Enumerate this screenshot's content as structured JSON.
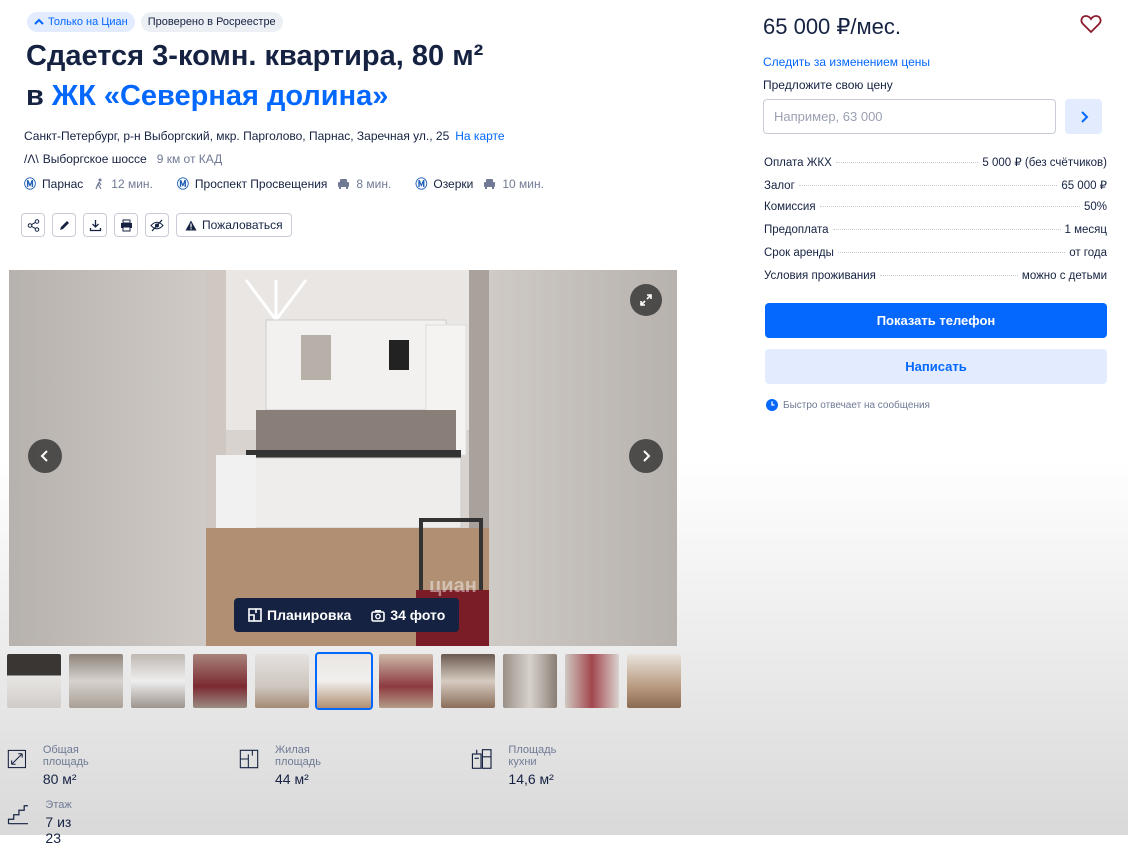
{
  "badges": {
    "only_cian": "Только на Циан",
    "verified": "Проверено в Росреестре"
  },
  "title": {
    "line1": "Сдается 3-комн. квартира, 80 м²",
    "in": "в ",
    "complex": "ЖК «Северная долина»"
  },
  "address": {
    "text": "Санкт-Петербург, р-н Выборгский, мкр. Парголово, Парнас, Заречная ул., 25",
    "map_link": "На карте"
  },
  "highway": {
    "name": "Выборгское шоссе",
    "distance": "9 км от КАД"
  },
  "metro": [
    {
      "station": "Парнас",
      "time": "12 мин.",
      "mode": "walk"
    },
    {
      "station": "Проспект Просвещения",
      "time": "8 мин.",
      "mode": "car"
    },
    {
      "station": "Озерки",
      "time": "10 мин.",
      "mode": "car"
    }
  ],
  "tools": {
    "complain": "Пожаловаться"
  },
  "gallery": {
    "layout_label": "Планировка",
    "photos_label": "34 фото",
    "watermark": "циан"
  },
  "facts": {
    "total_area": {
      "label": "Общая площадь",
      "value": "80 м²"
    },
    "living_area": {
      "label": "Жилая площадь",
      "value": "44 м²"
    },
    "kitchen_area": {
      "label": "Площадь кухни",
      "value": "14,6 м²"
    },
    "floor": {
      "label": "Этаж",
      "value": "7 из 23"
    }
  },
  "panel": {
    "price": "65 000 ₽/мес.",
    "follow": "Следить за изменением цены",
    "offer_label": "Предложите свою цену",
    "offer_placeholder": "Например, 63 000",
    "terms": [
      {
        "label": "Оплата ЖКХ",
        "value": "5 000 ₽ (без счётчиков)"
      },
      {
        "label": "Залог",
        "value": "65 000 ₽"
      },
      {
        "label": "Комиссия",
        "value": "50%"
      },
      {
        "label": "Предоплата",
        "value": "1 месяц"
      },
      {
        "label": "Срок аренды",
        "value": "от года"
      },
      {
        "label": "Условия проживания",
        "value": "можно с детьми"
      }
    ],
    "show_phone": "Показать телефон",
    "write": "Написать",
    "fast_reply": "Быстро отвечает на сообщения"
  },
  "colors": {
    "accent": "#0468ff",
    "text": "#152242",
    "muted": "#707a95"
  }
}
